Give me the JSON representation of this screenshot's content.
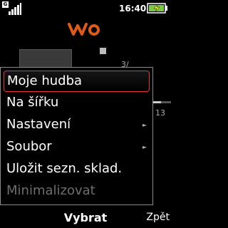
{
  "status_bar": {
    "network_indicator": "G",
    "time": "16:40",
    "signal_icon": "signal-strength-icon",
    "battery_icon": "battery-charging-icon"
  },
  "background": {
    "brand_icon": "walkman-logo-icon",
    "track_count": "3/",
    "elapsed": "13",
    "progress": 0.45,
    "player_state_icon": "stop-icon",
    "album_art_icon": "album-art-placeholder"
  },
  "menu": {
    "items": [
      {
        "label": "Moje hudba",
        "selected": true,
        "submenu": false,
        "enabled": true
      },
      {
        "label": "Na šířku",
        "selected": false,
        "submenu": false,
        "enabled": true
      },
      {
        "label": "Nastavení",
        "selected": false,
        "submenu": true,
        "enabled": true
      },
      {
        "label": "Soubor",
        "selected": false,
        "submenu": true,
        "enabled": true
      },
      {
        "label": "Uložit sezn. sklad.",
        "selected": false,
        "submenu": false,
        "enabled": true
      },
      {
        "label": "Minimalizovat",
        "selected": false,
        "submenu": false,
        "enabled": false
      }
    ],
    "submenu_arrow_glyph": "►"
  },
  "softkeys": {
    "center": "Vybrat",
    "right": "Zpět"
  },
  "colors": {
    "background": "#000000",
    "selection_border": "#e8372a",
    "brand_orange": "#e05a17",
    "disabled_text": "#6e6e6e"
  }
}
